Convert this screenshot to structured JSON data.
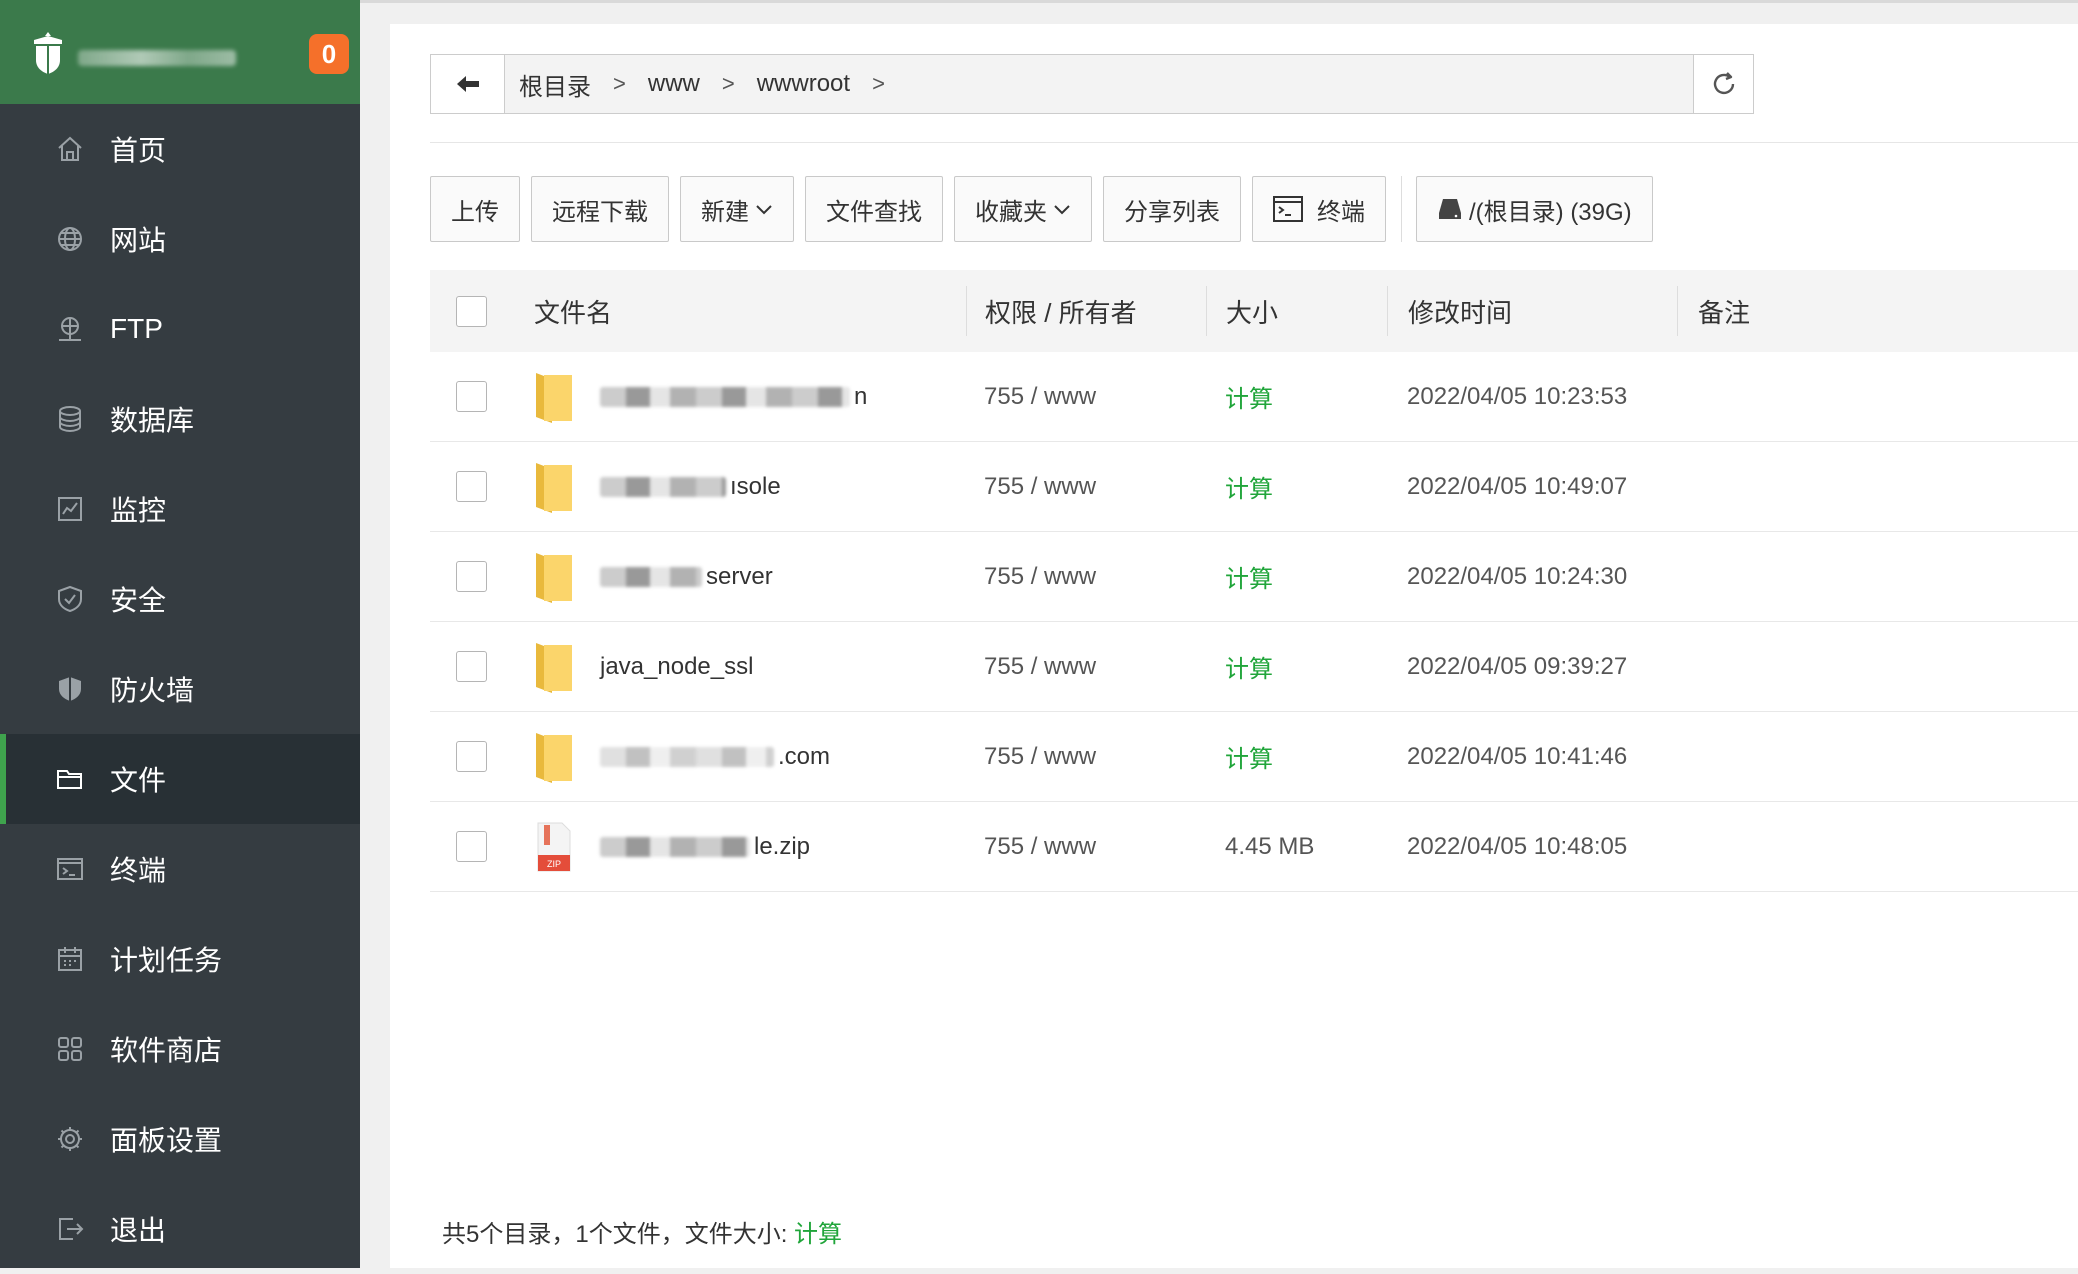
{
  "sidebar": {
    "badge": "0",
    "items": [
      {
        "label": "首页",
        "icon": "home-icon"
      },
      {
        "label": "网站",
        "icon": "globe-icon"
      },
      {
        "label": "FTP",
        "icon": "ftp-icon"
      },
      {
        "label": "数据库",
        "icon": "database-icon"
      },
      {
        "label": "监控",
        "icon": "monitor-icon"
      },
      {
        "label": "安全",
        "icon": "shield-check-icon"
      },
      {
        "label": "防火墙",
        "icon": "firewall-shield-icon"
      },
      {
        "label": "文件",
        "icon": "folder-icon"
      },
      {
        "label": "终端",
        "icon": "terminal-icon"
      },
      {
        "label": "计划任务",
        "icon": "calendar-icon"
      },
      {
        "label": "软件商店",
        "icon": "apps-grid-icon"
      },
      {
        "label": "面板设置",
        "icon": "gear-icon"
      },
      {
        "label": "退出",
        "icon": "logout-icon"
      }
    ],
    "active_index": 7
  },
  "breadcrumb": {
    "segments": [
      "根目录",
      "www",
      "wwwroot"
    ],
    "separator": ">"
  },
  "toolbar": {
    "upload": "上传",
    "remote_download": "远程下载",
    "new": "新建",
    "file_search": "文件查找",
    "favorites": "收藏夹",
    "share_list": "分享列表",
    "terminal": "终端",
    "disk": "/(根目录) (39G)"
  },
  "table": {
    "headers": {
      "name": "文件名",
      "perm_owner": "权限 / 所有者",
      "size": "大小",
      "mtime": "修改时间",
      "note": "备注"
    },
    "rows": [
      {
        "type": "folder",
        "name_visible": "n",
        "perm": "755 / www",
        "size": "计算",
        "mtime": "2022/04/05 10:23:53"
      },
      {
        "type": "folder",
        "name_visible": "ısole",
        "perm": "755 / www",
        "size": "计算",
        "mtime": "2022/04/05 10:49:07"
      },
      {
        "type": "folder",
        "name_visible": "server",
        "perm": "755 / www",
        "size": "计算",
        "mtime": "2022/04/05 10:24:30"
      },
      {
        "type": "folder",
        "name_visible": "java_node_ssl",
        "perm": "755 / www",
        "size": "计算",
        "mtime": "2022/04/05 09:39:27"
      },
      {
        "type": "folder",
        "name_visible": ".com",
        "perm": "755 / www",
        "size": "计算",
        "mtime": "2022/04/05 10:41:46"
      },
      {
        "type": "zip",
        "name_visible": "le.zip",
        "perm": "755 / www",
        "size": "4.45 MB",
        "mtime": "2022/04/05 10:48:05"
      }
    ]
  },
  "footer": {
    "summary": "共5个目录，1个文件，文件大小: ",
    "calc": "计算"
  },
  "colors": {
    "sidebar_bg": "#353c41",
    "header_green": "#3b7a4b",
    "accent_green": "#20a53a",
    "badge_orange": "#f5702a"
  }
}
